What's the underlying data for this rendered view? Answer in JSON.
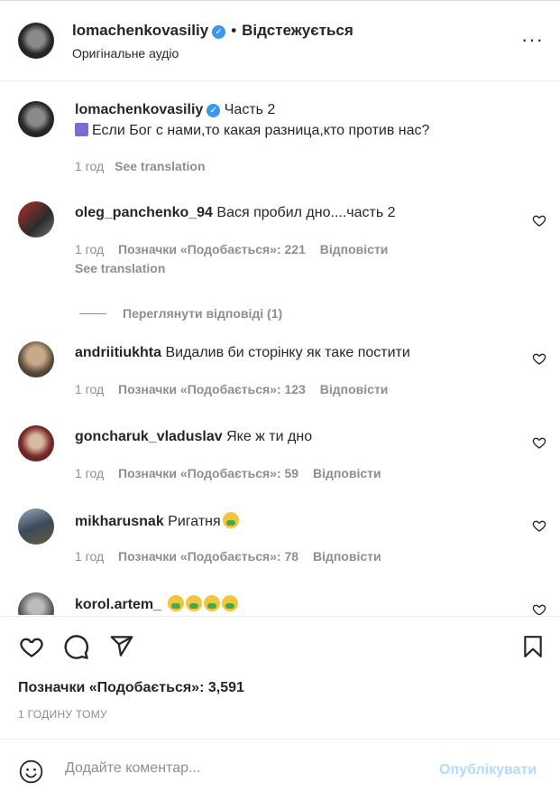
{
  "header": {
    "username": "lomachenkovasiliy",
    "verified_mark": "✓",
    "dot": "•",
    "follow_status": "Відстежується",
    "subtitle": "Оригінальне аудіо",
    "more": "···"
  },
  "caption": {
    "username": "lomachenkovasiliy",
    "title": "Часть 2",
    "text": "Если Бог с нами,то какая разница,кто против нас?",
    "time": "1 год",
    "translate": "See translation"
  },
  "comments": [
    {
      "username": "oleg_panchenko_94",
      "text": "Вася пробил дно....часть 2",
      "time": "1 год",
      "likes_label": "Позначки «Подобається»: 221",
      "reply": "Відповісти",
      "translate": "See translation",
      "view_replies": "Переглянути відповіді (1)"
    },
    {
      "username": "andriitiukhta",
      "text": "Видалив би сторінку як таке постити",
      "time": "1 год",
      "likes_label": "Позначки «Подобається»: 123",
      "reply": "Відповісти"
    },
    {
      "username": "goncharuk_vladuslav",
      "text": "Яке ж ти дно",
      "time": "1 год",
      "likes_label": "Позначки «Подобається»: 59",
      "reply": "Відповісти"
    },
    {
      "username": "mikharusnak",
      "text": "Ригатня",
      "time": "1 год",
      "likes_label": "Позначки «Подобається»: 78",
      "reply": "Відповісти"
    },
    {
      "username": "korol.artem_",
      "text": ""
    }
  ],
  "likes": "Позначки «Подобається»: 3,591",
  "posted_time": "1 ГОДИНУ ТОМУ",
  "add_comment": {
    "placeholder": "Додайте коментар...",
    "post_label": "Опублікувати"
  },
  "icons": [
    "heart-icon",
    "comment-icon",
    "share-icon",
    "bookmark-icon",
    "emoji-icon",
    "more-icon",
    "verified-icon"
  ],
  "colors": {
    "verified": "#3897f0",
    "muted": "#8e8e8e",
    "post_disabled": "#b3dbff"
  }
}
